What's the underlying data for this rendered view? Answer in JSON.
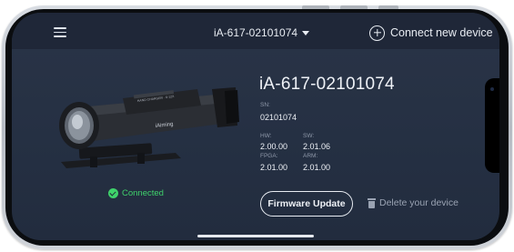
{
  "header": {
    "device_name": "iA-617-02101074",
    "connect_new_label": "Connect new device"
  },
  "device": {
    "title": "iA-617-02101074",
    "sn_label": "SN:",
    "sn_value": "02101074",
    "hw_label": "HW:",
    "hw_value": "2.00.00",
    "sw_label": "SW:",
    "sw_value": "2.01.06",
    "fpga_label": "FPGA:",
    "fpga_value": "2.01.00",
    "arm_label": "ARM:",
    "arm_value": "2.01.00",
    "scope_brand": "iAiming",
    "scope_side_text": "HAND CHARGER · 6-12X"
  },
  "status": {
    "connected_label": "Connected",
    "color": "#3fd26b"
  },
  "actions": {
    "firmware_update_label": "Firmware Update",
    "delete_label": "Delete your device"
  },
  "icons": [
    "hamburger-menu-icon",
    "dropdown-caret-icon",
    "plus-circle-icon",
    "check-circle-icon",
    "trash-icon"
  ]
}
